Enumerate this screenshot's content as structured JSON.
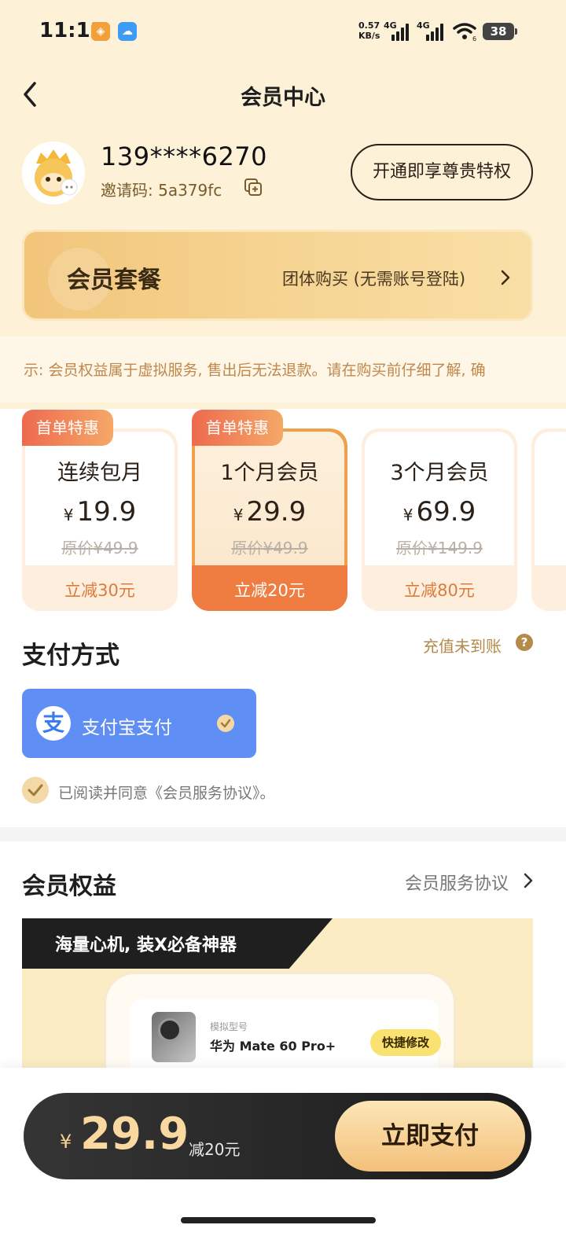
{
  "status_bar": {
    "time": "11:11",
    "net_speed_value": "0.57",
    "net_speed_unit": "KB/s",
    "net1": "4G",
    "net2": "4G",
    "wifi_sub": "6",
    "battery": "38"
  },
  "header": {
    "title": "会员中心"
  },
  "profile": {
    "phone": "139****6270",
    "invite_label": "邀请码: 5a379fc",
    "vip_button": "开通即享尊贵特权"
  },
  "package_banner": {
    "title": "会员套餐",
    "group_buy": "团体购买 (无需账号登陆)"
  },
  "notice": {
    "text": "示: 会员权益属于虚拟服务, 售出后无法退款。请在购买前仔细了解, 确"
  },
  "plans": [
    {
      "tag": "首单特惠",
      "name": "连续包月",
      "currency": "¥",
      "price": "19.9",
      "original": "原价¥49.9",
      "discount": "立减30元",
      "selected": false
    },
    {
      "tag": "首单特惠",
      "name": "1个月会员",
      "currency": "¥",
      "price": "29.9",
      "original": "原价¥49.9",
      "discount": "立减20元",
      "selected": true
    },
    {
      "tag": "",
      "name": "3个月会员",
      "currency": "¥",
      "price": "69.9",
      "original": "原价¥149.9",
      "discount": "立减80元",
      "selected": false
    }
  ],
  "payment": {
    "title": "支付方式",
    "recharge_help": "充值未到账",
    "help_icon": "?",
    "method_icon": "支",
    "method_label": "支付宝支付",
    "agreement": "已阅读并同意《会员服务协议》。"
  },
  "benefits": {
    "title": "会员权益",
    "link": "会员服务协议",
    "banner_title": "海量心机, 装X必备神器",
    "demo_sub": "模拟型号",
    "demo_model": "华为 Mate 60 Pro+",
    "demo_button": "快捷修改"
  },
  "bottom_bar": {
    "currency": "¥",
    "total": "29.9",
    "discount": "减20元",
    "pay_button": "立即支付"
  },
  "colors": {
    "top_bg": "#fdf1d8",
    "accent_orange": "#ef7c40",
    "alipay_blue": "#5f8ef5",
    "gold": "#f3c07a"
  }
}
